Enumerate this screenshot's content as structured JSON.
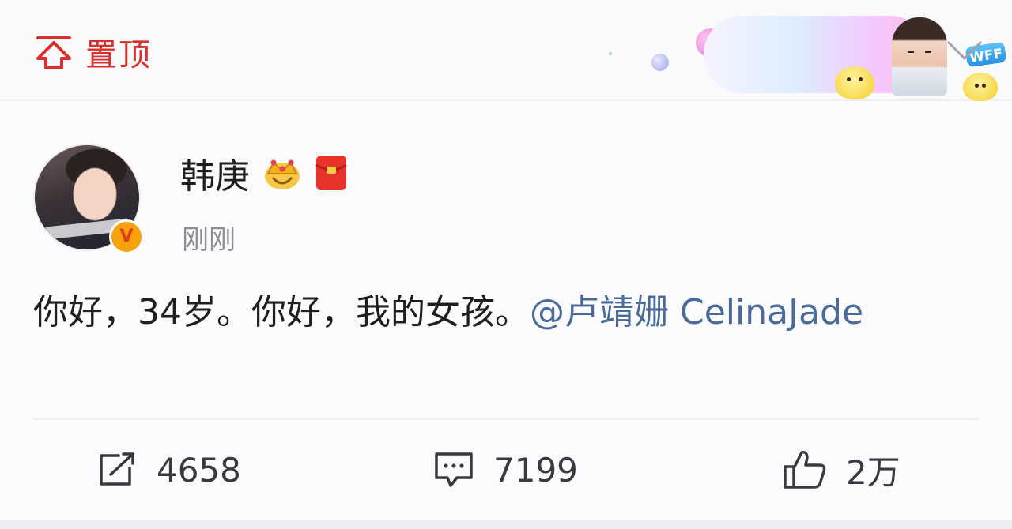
{
  "pinned": {
    "label": "置顶",
    "icon": "pin-top-icon"
  },
  "promo": {
    "badge_text": "WFF",
    "icon": "promo-banner"
  },
  "more_icon": "chevron-down-icon",
  "post": {
    "author": {
      "name": "韩庚",
      "verified_icon": "verified-v-badge",
      "verified_text": "V"
    },
    "badges": [
      "crown-icon",
      "red-packet-icon"
    ],
    "time": "刚刚",
    "content": {
      "text": "你好，34岁。你好，我的女孩。",
      "mention": "@卢靖姗 CelinaJade"
    }
  },
  "actions": {
    "repost": {
      "icon": "repost-icon",
      "count": "4658"
    },
    "comment": {
      "icon": "comment-icon",
      "count": "7199"
    },
    "like": {
      "icon": "thumbs-up-icon",
      "count": "2万"
    }
  },
  "colors": {
    "accent_red": "#d9302e",
    "mention_blue": "#4a6a9a",
    "text_dark": "#1f1f1f",
    "text_gray": "#8d8d95"
  }
}
